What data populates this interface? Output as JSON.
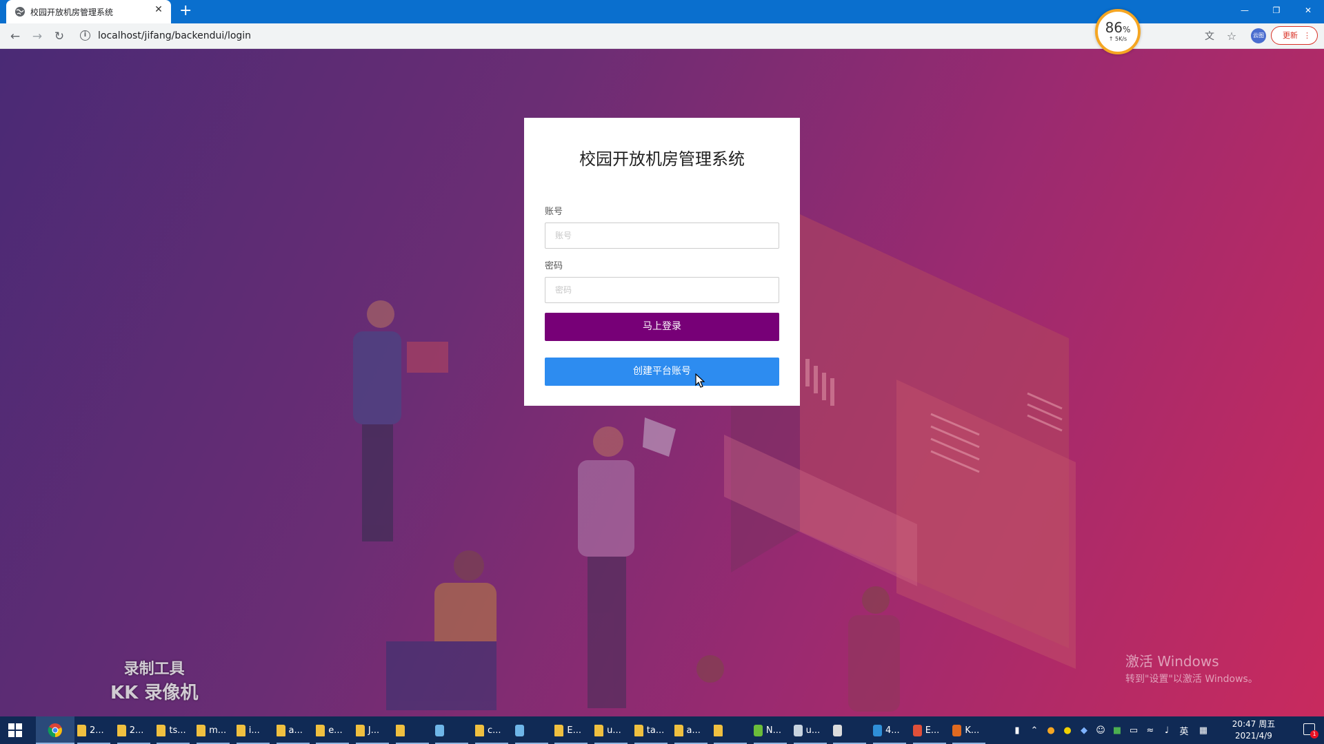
{
  "browser": {
    "tab_title": "校园开放机房管理系统",
    "new_tab": "+",
    "close_tab": "✕",
    "url": "localhost/jifang/backendui/login",
    "update_label": "更新",
    "profile_label": "云图"
  },
  "speed_widget": {
    "percent": "86",
    "percent_sign": "%",
    "rate": "↑ 5K/s"
  },
  "login": {
    "title": "校园开放机房管理系统",
    "account_label": "账号",
    "account_placeholder": "账号",
    "account_value": "",
    "password_label": "密码",
    "password_placeholder": "密码",
    "password_value": "",
    "login_button": "马上登录",
    "create_button": "创建平台账号",
    "colors": {
      "login_button": "#770077",
      "create_button": "#2d8cf0"
    }
  },
  "watermark": {
    "line1": "录制工具",
    "line2": "KK 录像机"
  },
  "windows_activation": {
    "line1": "激活 Windows",
    "line2": "转到\"设置\"以激活 Windows。"
  },
  "taskbar": {
    "apps": [
      {
        "label": "2...",
        "icon": "folder-icon"
      },
      {
        "label": "2...",
        "icon": "folder-icon"
      },
      {
        "label": "ts...",
        "icon": "folder-icon"
      },
      {
        "label": "m...",
        "icon": "folder-icon"
      },
      {
        "label": "i...",
        "icon": "folder-icon"
      },
      {
        "label": "a...",
        "icon": "folder-icon"
      },
      {
        "label": "e...",
        "icon": "folder-icon"
      },
      {
        "label": "J...",
        "icon": "folder-icon"
      },
      {
        "label": "",
        "icon": "folder-icon"
      },
      {
        "label": "",
        "icon": "cube-icon"
      },
      {
        "label": "c...",
        "icon": "folder-icon"
      },
      {
        "label": "",
        "icon": "cube-icon"
      },
      {
        "label": "E...",
        "icon": "folder-icon"
      },
      {
        "label": "u...",
        "icon": "folder-icon"
      },
      {
        "label": "ta...",
        "icon": "folder-icon"
      },
      {
        "label": "a...",
        "icon": "folder-icon"
      },
      {
        "label": "",
        "icon": "folder-icon"
      },
      {
        "label": "N...",
        "icon": "node-icon"
      },
      {
        "label": "u...",
        "icon": "server-icon"
      },
      {
        "label": "",
        "icon": "feather-icon"
      },
      {
        "label": "4...",
        "icon": "vscode-icon"
      },
      {
        "label": "E...",
        "icon": "editor-icon"
      },
      {
        "label": "K...",
        "icon": "recorder-icon"
      }
    ],
    "ime": "英",
    "time": "20:47 周五",
    "date": "2021/4/9",
    "notification_count": "1"
  }
}
